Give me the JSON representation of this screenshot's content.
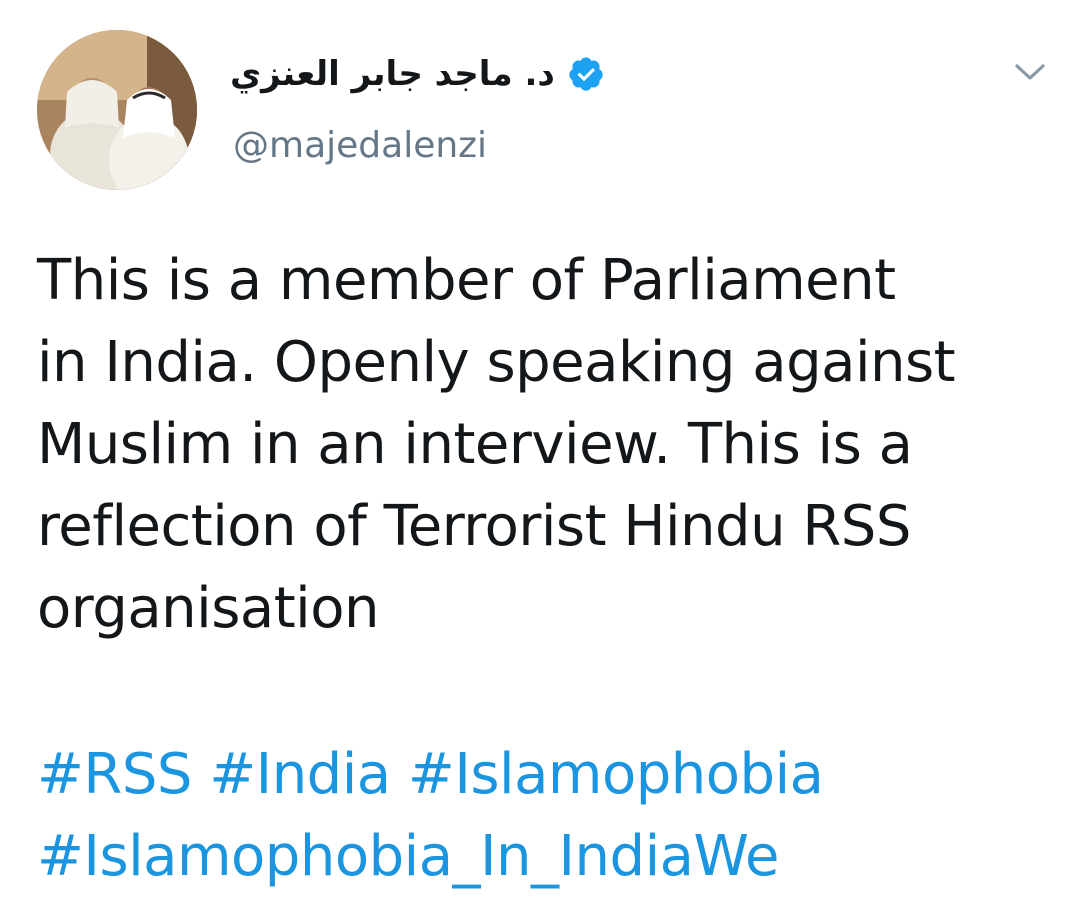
{
  "author": {
    "display_name": "د. ماجد جابر العنزي",
    "handle": "@majedalenzi",
    "verified": true
  },
  "tweet": {
    "lines": [
      "This is a member of Parliament",
      "in India. Openly speaking against",
      "Muslim in an interview. This is a",
      "reflection of Terrorist Hindu RSS",
      "organisation"
    ],
    "hashtag_lines": [
      [
        "#RSS",
        "#India",
        "#Islamophobia"
      ],
      [
        "#Islamophobia_In_IndiaWe"
      ]
    ]
  },
  "icons": {
    "verified": "verified-badge-icon",
    "menu": "chevron-down-icon"
  },
  "colors": {
    "text": "#14171a",
    "secondary": "#657786",
    "link": "#1b95e0",
    "verified": "#1da1f2"
  }
}
